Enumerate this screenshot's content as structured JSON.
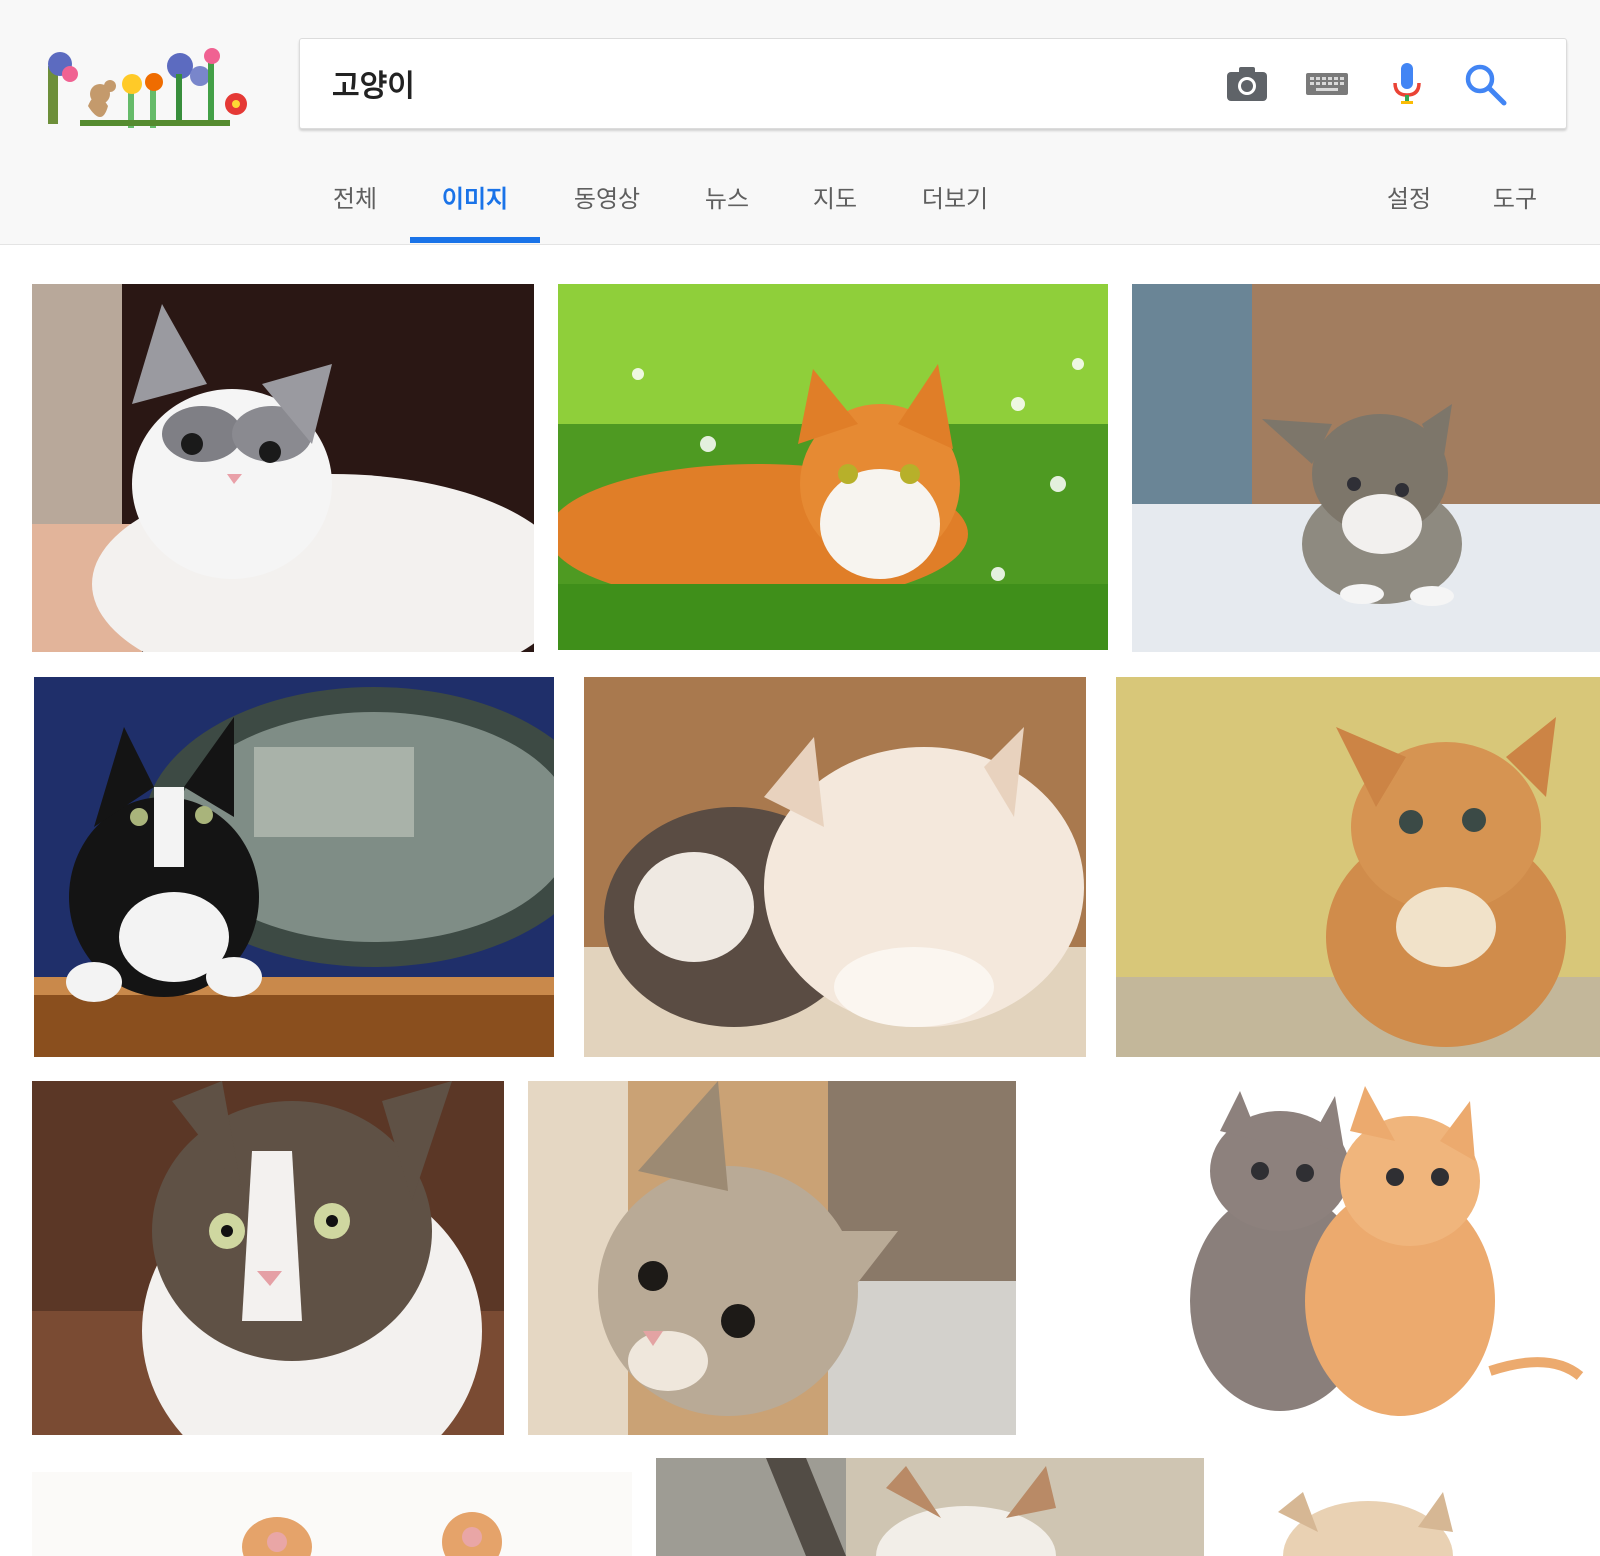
{
  "search": {
    "query": "고양이",
    "icons": {
      "camera": "camera-icon",
      "keyboard": "keyboard-icon",
      "mic": "microphone-icon",
      "search": "search-icon"
    }
  },
  "logo": {
    "name": "google-doodle-flowers",
    "colors": [
      "#f06292",
      "#ffca28",
      "#66bb6a",
      "#5c6bc0",
      "#8d6e63"
    ]
  },
  "tabs": [
    {
      "label": "전체",
      "active": false
    },
    {
      "label": "이미지",
      "active": true
    },
    {
      "label": "동영상",
      "active": false
    },
    {
      "label": "뉴스",
      "active": false
    },
    {
      "label": "지도",
      "active": false
    },
    {
      "label": "더보기",
      "active": false
    }
  ],
  "tools": [
    {
      "label": "설정"
    },
    {
      "label": "도구"
    }
  ],
  "colors": {
    "accent": "#1a73e8",
    "header_bg": "#f8f8f8",
    "tab_text": "#5f5f5f"
  },
  "results": [
    {
      "subject": "gray-white kitten lying"
    },
    {
      "subject": "orange-white cat in grass"
    },
    {
      "subject": "tabby kitten on table"
    },
    {
      "subject": "tuxedo cat at podium"
    },
    {
      "subject": "two fluffy kittens sleeping"
    },
    {
      "subject": "orange kitten on yellow background"
    },
    {
      "subject": "tabby-white cat close-up"
    },
    {
      "subject": "kitten peeking from box"
    },
    {
      "subject": "gray and orange kittens"
    },
    {
      "subject": "orange kitten paws up"
    },
    {
      "subject": "cat behind window"
    },
    {
      "subject": "cream kitten"
    }
  ]
}
